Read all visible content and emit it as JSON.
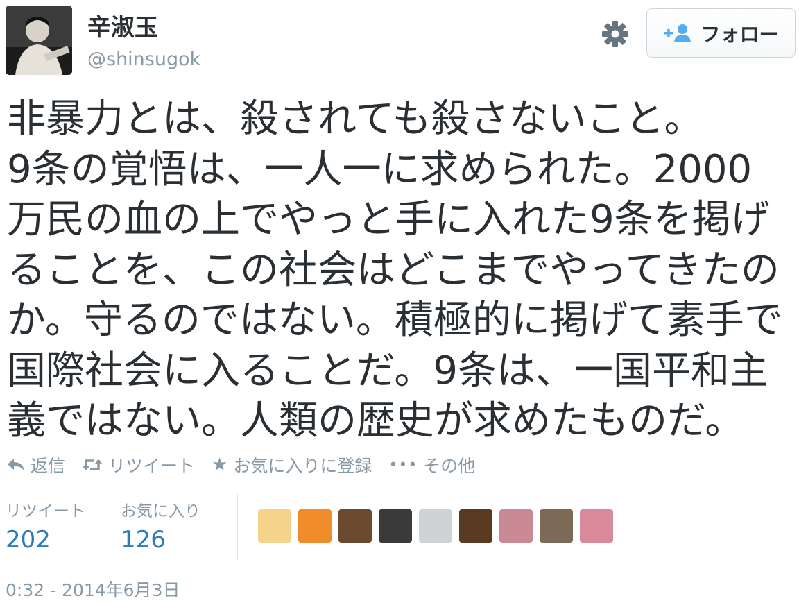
{
  "user": {
    "display_name": "辛淑玉",
    "handle": "@shinsugok",
    "avatar_icon": "profile-photo"
  },
  "header": {
    "settings_icon": "gear-icon",
    "follow_icon": "add-user-icon",
    "follow_label": "フォロー"
  },
  "tweet": {
    "lines": [
      "非暴力とは、殺されても殺さないこと。",
      "9条の覚悟は、一人一に求められた。2000",
      "万民の血の上でやっと手に入れた9条を掲げ",
      "ることを、この社会はどこまでやってきたの",
      "か。守るのではない。積極的に掲げて素手で",
      "国際社会に入ることだ。9条は、一国平和主",
      "義ではない。人類の歴史が求めたものだ。"
    ]
  },
  "actions": {
    "reply": "返信",
    "retweet": "リツイート",
    "favorite": "お気に入りに登録",
    "more": "その他"
  },
  "stats": {
    "retweets_label": "リツイート",
    "retweets_value": "202",
    "favorites_label": "お気に入り",
    "favorites_value": "126"
  },
  "favoriters": [
    {
      "icon": "cartoon-character-avatar",
      "color": "#f6d38a"
    },
    {
      "icon": "orange-cat-avatar",
      "color": "#f08c2a"
    },
    {
      "icon": "photo-avatar",
      "color": "#6b4a2f"
    },
    {
      "icon": "logo-avatar",
      "color": "#3a3a3a"
    },
    {
      "icon": "white-cat-avatar",
      "color": "#cfd3d6"
    },
    {
      "icon": "stained-glass-avatar",
      "color": "#5a3b22"
    },
    {
      "icon": "pink-flower-avatar",
      "color": "#c98a96"
    },
    {
      "icon": "cat-photo-avatar",
      "color": "#7b6a55"
    },
    {
      "icon": "person-photo-avatar",
      "color": "#d98a9a"
    }
  ],
  "timestamp": "0:32 - 2014年6月3日"
}
